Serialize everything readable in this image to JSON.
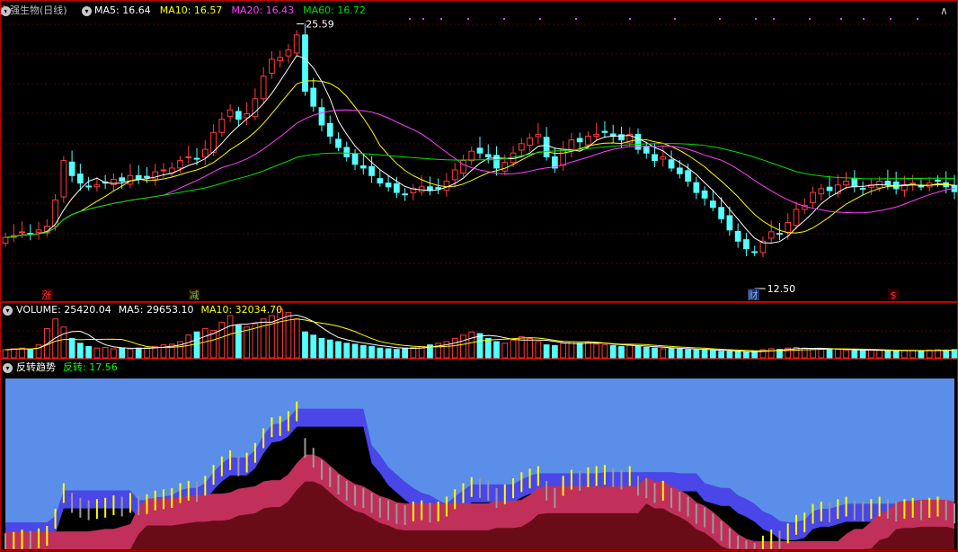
{
  "stock": {
    "name": "九强生物(日线)"
  },
  "price_panel": {
    "ma_labels": [
      {
        "text": "MA5: 16.64",
        "color": "#ffffff"
      },
      {
        "text": "MA10: 16.57",
        "color": "#ffff00"
      },
      {
        "text": "MA20: 16.43",
        "color": "#ff40ff"
      },
      {
        "text": "MA60: 16.72",
        "color": "#00e000"
      }
    ],
    "high_label": "25.59",
    "low_label": "12.50",
    "signals": [
      {
        "text": "涨",
        "color": "#ff3030"
      },
      {
        "text": "减",
        "color": "#50d050"
      },
      {
        "text": "财",
        "color": "#80b0ff"
      },
      {
        "text": "$",
        "color": "#ff3030"
      }
    ]
  },
  "volume_panel": {
    "labels": [
      {
        "text": "VOLUME: 25420.04",
        "color": "#ffffff"
      },
      {
        "text": "MA5: 29653.10",
        "color": "#ffffff"
      },
      {
        "text": "MA10: 32034.70",
        "color": "#ffff00"
      }
    ]
  },
  "indicator_panel": {
    "title": "反转趋势",
    "value_label": "反转: 17.56",
    "value_color": "#00ff00"
  },
  "colors": {
    "up": "#ff3b3b",
    "down": "#54ffff",
    "grid": "#5a0000",
    "border": "#c00000"
  },
  "chart_data": {
    "type": "candlestick",
    "price_range": [
      12.5,
      25.59
    ],
    "closes": [
      14.2,
      14.3,
      14.5,
      14.4,
      14.6,
      14.8,
      16.2,
      18.3,
      17.5,
      17.1,
      16.9,
      17.0,
      17.1,
      17.3,
      17.2,
      17.5,
      17.3,
      17.4,
      17.7,
      17.8,
      17.9,
      18.3,
      18.5,
      18.4,
      18.9,
      19.8,
      20.5,
      21.0,
      20.5,
      20.8,
      21.6,
      22.8,
      23.7,
      23.8,
      24.2,
      25.0,
      22.0,
      21.2,
      20.2,
      19.6,
      19.0,
      18.5,
      18.1,
      17.9,
      17.5,
      17.1,
      16.9,
      16.6,
      16.5,
      16.8,
      16.9,
      16.7,
      16.8,
      17.2,
      17.8,
      18.3,
      18.8,
      18.7,
      18.5,
      17.9,
      18.2,
      18.7,
      19.2,
      19.5,
      19.7,
      18.5,
      17.9,
      18.9,
      19.4,
      19.3,
      19.6,
      19.7,
      19.8,
      19.6,
      19.4,
      19.7,
      18.9,
      18.7,
      18.3,
      18.5,
      17.9,
      17.6,
      17.2,
      16.6,
      16.3,
      15.8,
      15.2,
      14.6,
      14.0,
      13.6,
      13.4,
      14.0,
      14.5,
      14.4,
      15.0,
      15.7,
      15.9,
      16.6,
      16.8,
      16.7,
      17.0,
      17.2,
      16.9,
      16.8,
      17.0,
      17.2,
      17.0,
      16.8,
      17.0,
      17.1,
      16.9,
      17.1,
      17.2,
      16.9,
      16.64
    ],
    "volumes": [
      25000,
      28000,
      30000,
      26000,
      40000,
      90000,
      120000,
      95000,
      60000,
      45000,
      35000,
      30000,
      32000,
      28000,
      30000,
      27000,
      30000,
      31000,
      35000,
      40000,
      42000,
      50000,
      70000,
      80000,
      90000,
      85000,
      110000,
      130000,
      100000,
      95000,
      105000,
      120000,
      130000,
      150000,
      140000,
      120000,
      80000,
      70000,
      60000,
      55000,
      50000,
      45000,
      42000,
      38000,
      35000,
      30000,
      28000,
      26000,
      30000,
      32000,
      35000,
      40000,
      45000,
      50000,
      60000,
      70000,
      80000,
      75000,
      60000,
      50000,
      45000,
      55000,
      65000,
      60000,
      50000,
      40000,
      38000,
      45000,
      50000,
      45000,
      48000,
      42000,
      40000,
      38000,
      35000,
      40000,
      35000,
      32000,
      30000,
      28000,
      30000,
      27000,
      25000,
      24000,
      26000,
      22000,
      20000,
      19000,
      18000,
      17000,
      20000,
      25000,
      28000,
      26000,
      30000,
      32000,
      30000,
      28000,
      27000,
      25000,
      26000,
      24000,
      23000,
      22000,
      24000,
      23000,
      22000,
      21000,
      22000,
      23000,
      21000,
      24000,
      25000,
      24000,
      25420
    ],
    "ma": {
      "MA5": 16.64,
      "MA10": 16.57,
      "MA20": 16.43,
      "MA60": 16.72
    },
    "volume_ma": {
      "MA5": 29653.1,
      "MA10": 32034.7
    },
    "reversal_value": 17.56
  }
}
